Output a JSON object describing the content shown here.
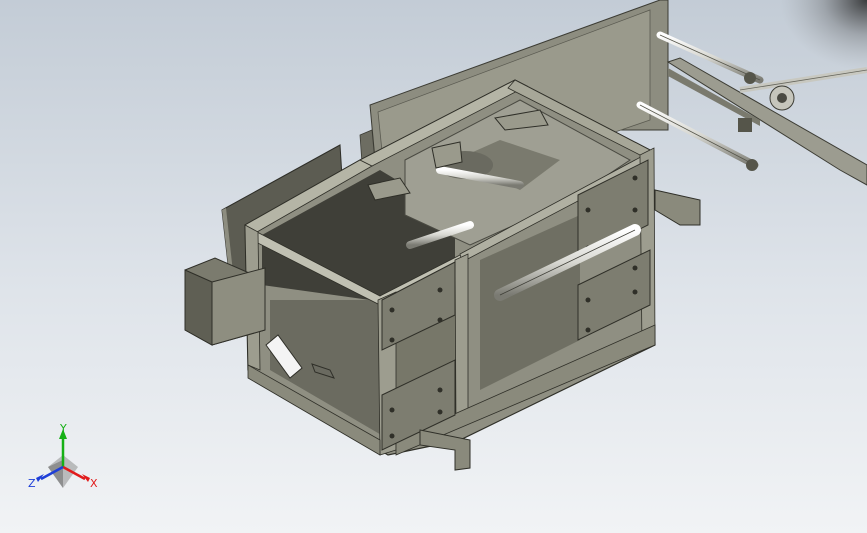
{
  "view": {
    "name": "CAD 3D viewport",
    "colors": {
      "background_top": "#c3ccd6",
      "background_bottom": "#f1f3f5",
      "frame_dark": "#55554a",
      "frame_mid": "#8a8a7c",
      "frame_light": "#b8b8a8",
      "rod": "#e9e9e4",
      "panel_white": "#f4f4f4",
      "axis_x": "#e11b1b",
      "axis_y": "#16b016",
      "axis_z": "#1e3fd8"
    }
  },
  "triad": {
    "x_label": "X",
    "y_label": "Y",
    "z_label": "Z",
    "icon": "xyz-triad-icon"
  }
}
